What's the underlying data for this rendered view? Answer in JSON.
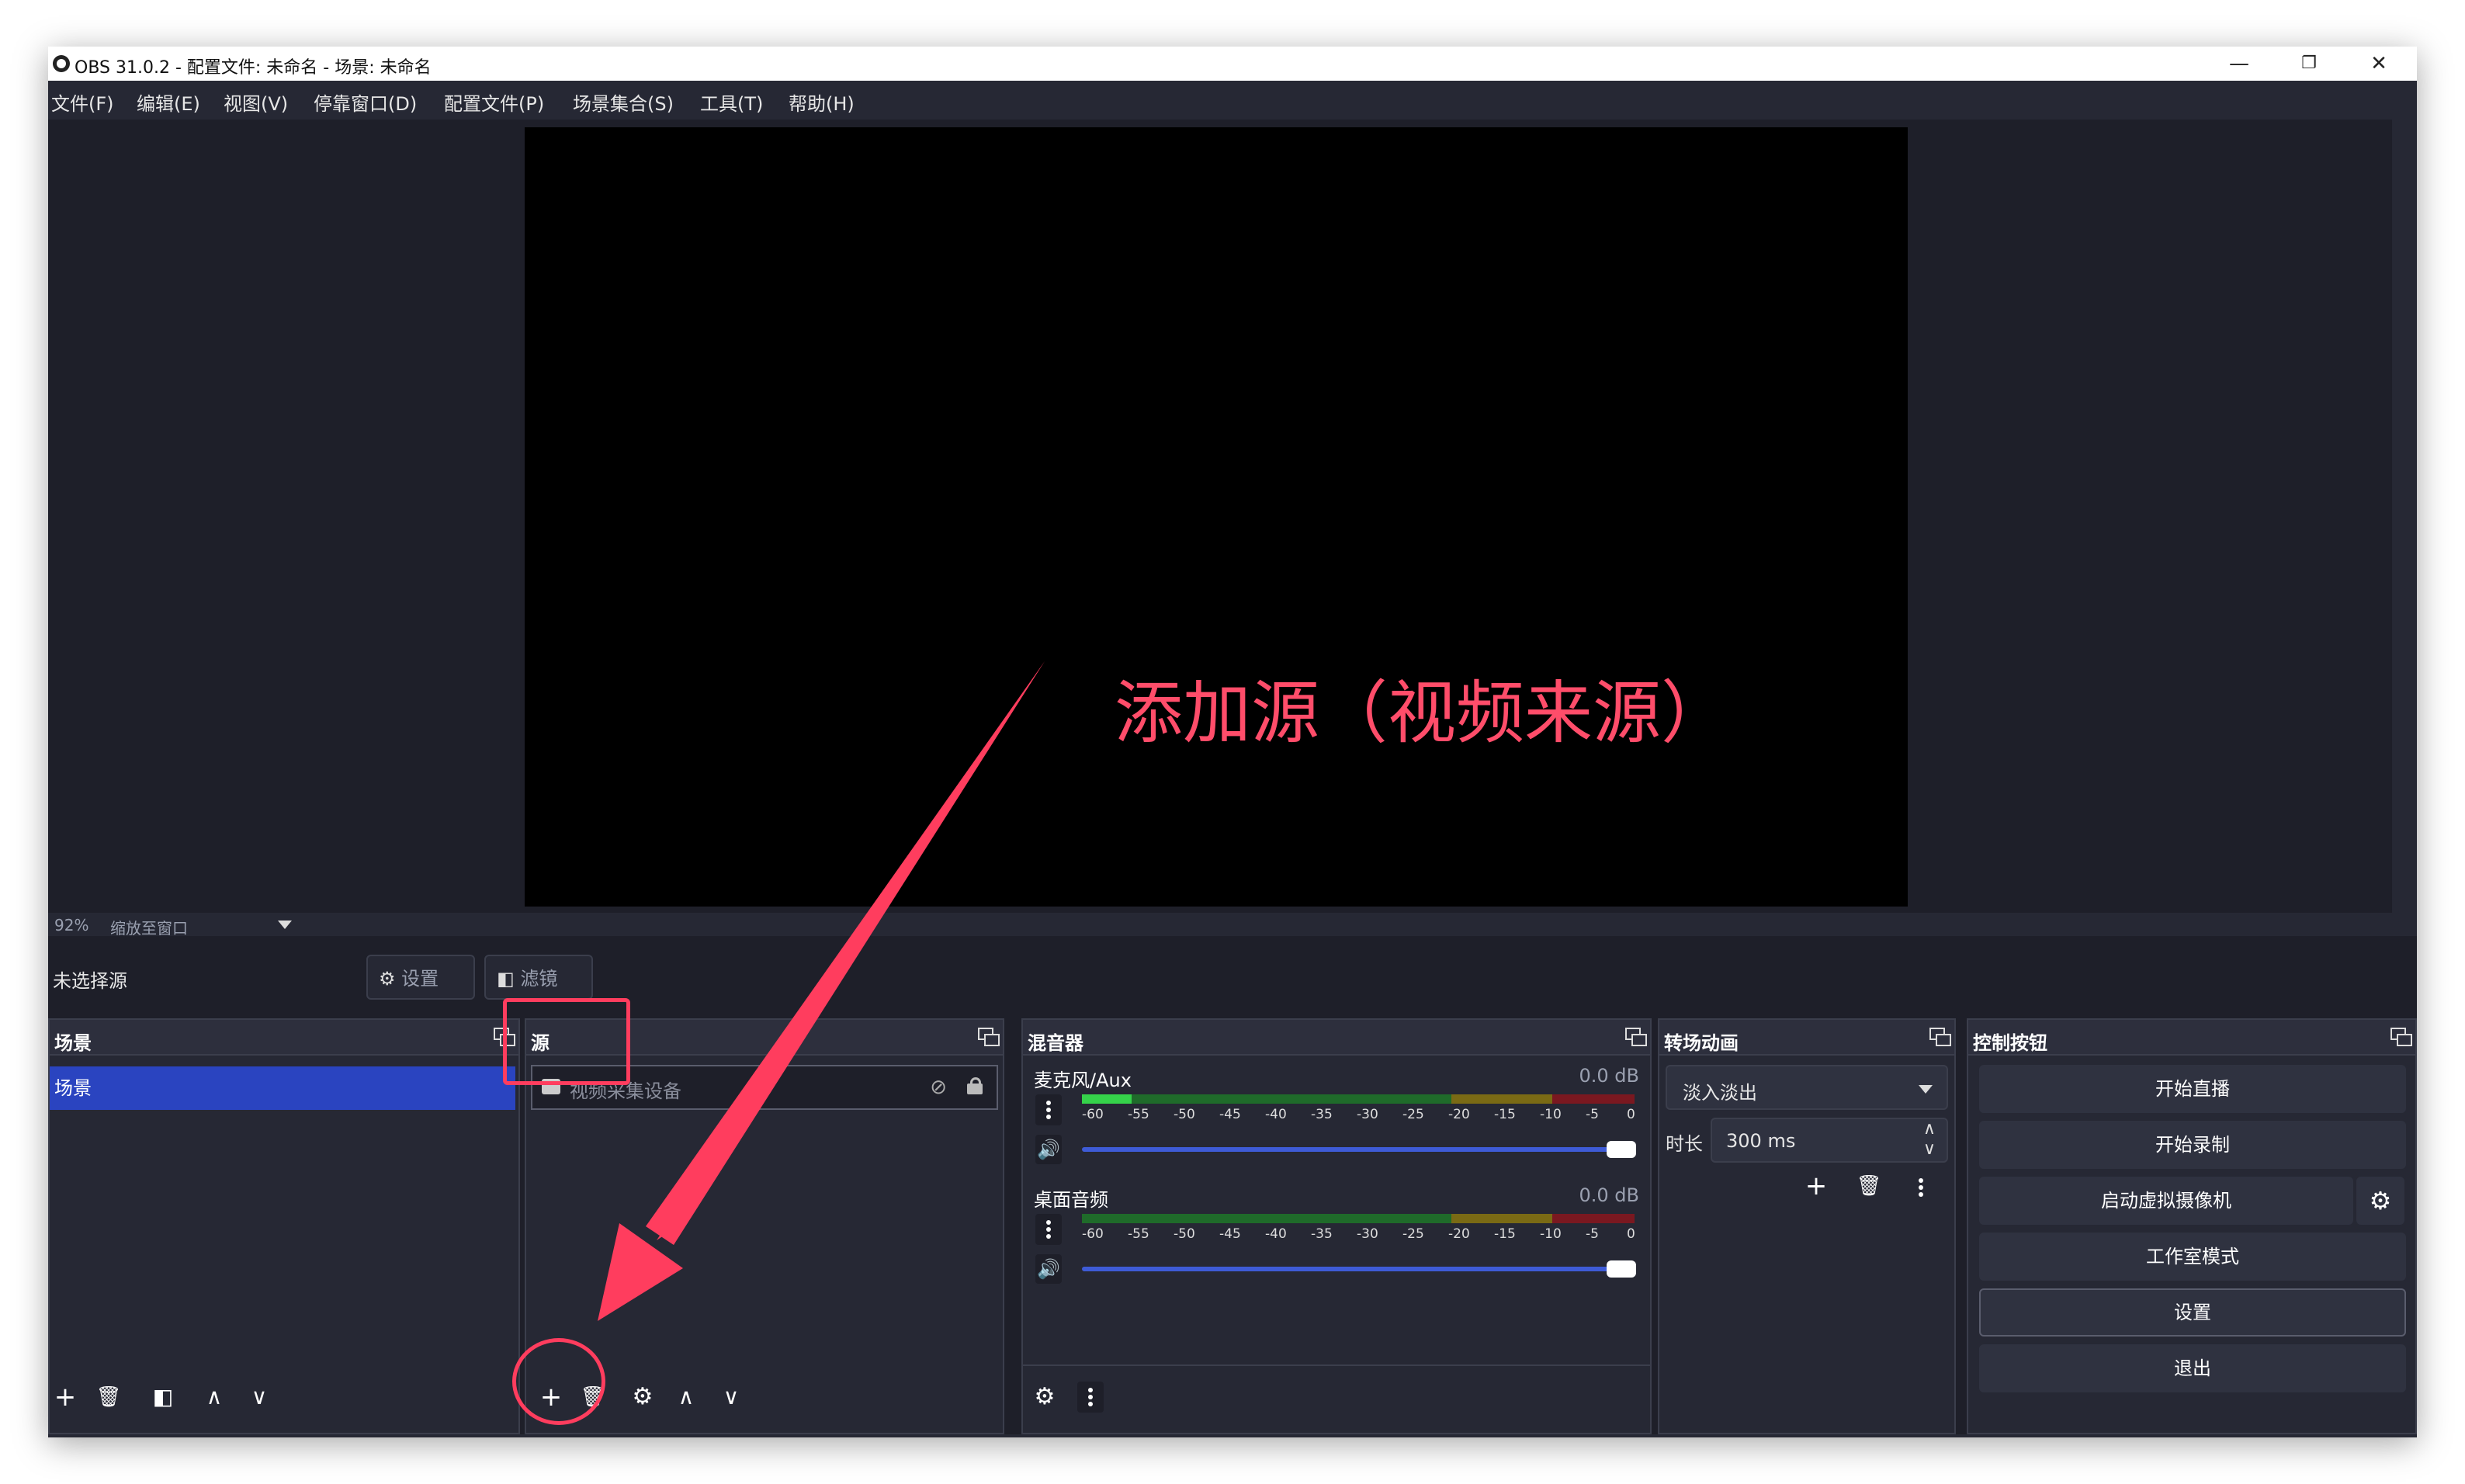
{
  "window": {
    "title": "OBS 31.0.2 - 配置文件: 未命名 - 场景: 未命名",
    "controls": {
      "minimize": "—",
      "maximize": "❐",
      "close": "✕"
    }
  },
  "menu": [
    "文件(F)",
    "编辑(E)",
    "视图(V)",
    "停靠窗口(D)",
    "配置文件(P)",
    "场景集合(S)",
    "工具(T)",
    "帮助(H)"
  ],
  "zoom": {
    "value": "92%",
    "mode": "缩放至窗口"
  },
  "source_bar": {
    "no_source": "未选择源",
    "settings": "设置",
    "filters": "滤镜"
  },
  "scenes": {
    "title": "场景",
    "items": [
      "场景"
    ]
  },
  "sources": {
    "title": "源",
    "items": [
      {
        "name": "视频采集设备"
      }
    ]
  },
  "mixer": {
    "title": "混音器",
    "channels": [
      {
        "name": "麦克风/Aux",
        "db": "0.0 dB",
        "level": 0.09
      },
      {
        "name": "桌面音频",
        "db": "0.0 dB",
        "level": 0.0
      }
    ],
    "ticks": [
      "-60",
      "-55",
      "-50",
      "-45",
      "-40",
      "-35",
      "-30",
      "-25",
      "-20",
      "-15",
      "-10",
      "-5",
      "0"
    ]
  },
  "transitions": {
    "title": "转场动画",
    "selected": "淡入淡出",
    "duration_label": "时长",
    "duration": "300 ms"
  },
  "controls": {
    "title": "控制按钮",
    "buttons": [
      "开始直播",
      "开始录制",
      "启动虚拟摄像机",
      "工作室模式",
      "设置",
      "退出"
    ]
  },
  "annotation": {
    "text": "添加源（视频来源）",
    "color": "#ff4d6a"
  },
  "colors": {
    "accent": "#2a44c0",
    "background": "#1e1f29",
    "panel": "#262834",
    "annotation": "#ff3d5e"
  }
}
